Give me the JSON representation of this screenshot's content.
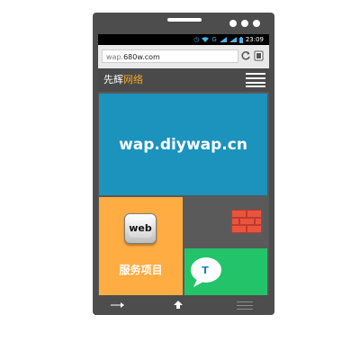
{
  "statusbar": {
    "time": "23:09",
    "network_label": "G"
  },
  "browser": {
    "url_scheme_part": "wap.",
    "url_host_part": "680w.com"
  },
  "site": {
    "logo_primary": "先辉",
    "logo_accent": "网络",
    "banner_text": "wap.diywap.cn",
    "tiles": {
      "services": {
        "icon_label": "web",
        "label": "服务项目"
      },
      "chat": {
        "icon_label": "T"
      }
    }
  },
  "colors": {
    "banner": "#1b93bd",
    "services": "#ffac42",
    "chat": "#22c46a",
    "accent": "#f5a623",
    "phone_body": "#4d4d4d"
  },
  "icons": [
    "wifi-icon",
    "signal-icon",
    "battery-icon",
    "reload-icon",
    "tabs-icon",
    "menu-icon",
    "web-key-icon",
    "brick-wall-icon",
    "chat-bubble-icon",
    "back-arrow-icon",
    "home-icon",
    "overflow-menu-icon"
  ]
}
